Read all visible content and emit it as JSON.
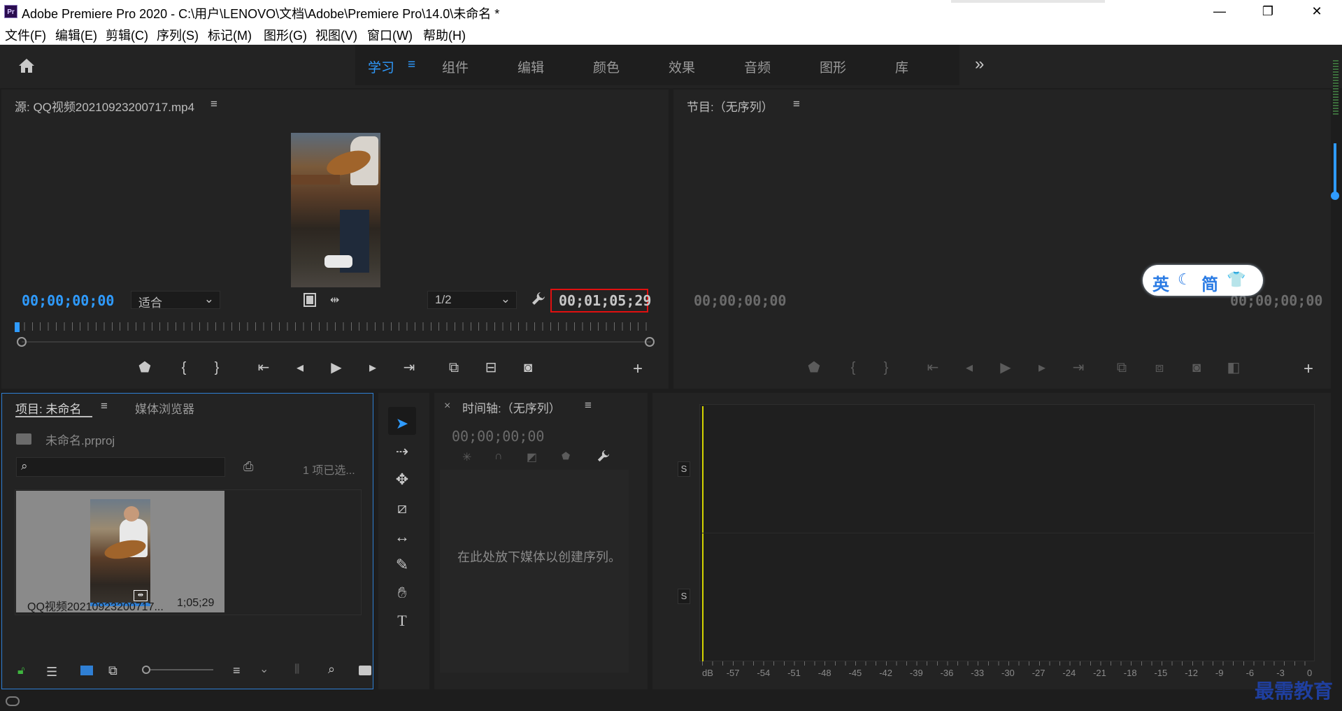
{
  "window": {
    "title": "Adobe Premiere Pro 2020 - C:\\用户\\LENOVO\\文档\\Adobe\\Premiere Pro\\14.0\\未命名 *",
    "logo": "Pr",
    "minimize": "—",
    "restore": "❐",
    "close": "✕"
  },
  "menu": [
    "文件(F)",
    "编辑(E)",
    "剪辑(C)",
    "序列(S)",
    "标记(M)",
    "图形(G)",
    "视图(V)",
    "窗口(W)",
    "帮助(H)"
  ],
  "workspaces": {
    "items": [
      "学习",
      "组件",
      "编辑",
      "颜色",
      "效果",
      "音频",
      "图形",
      "库"
    ],
    "active_menu": "≡",
    "more": "»"
  },
  "source": {
    "title": "源: QQ视频20210923200717.mp4",
    "menu_icon": "≡",
    "timecode_in": "00;00;00;00",
    "fit": "适合",
    "resolution": "1/2",
    "duration": "00;01;05;29"
  },
  "program": {
    "title": "节目:（无序列）",
    "menu_icon": "≡",
    "tc_left": "00;00;00;00",
    "tc_right": "00;00;00;00"
  },
  "project": {
    "tab_project": "项目: 未命名",
    "tab_media": "媒体浏览器",
    "menu_icon": "≡",
    "file": "未命名.prproj",
    "selection": "1 项已选...",
    "clip_name": "QQ视频20210923200717...",
    "clip_duration": "1;05;29"
  },
  "timeline": {
    "close": "×",
    "title": "时间轴:（无序列）",
    "menu_icon": "≡",
    "timecode": "00;00;00;00",
    "empty_text": "在此处放下媒体以创建序列。"
  },
  "audio_meter": {
    "s_label": "S",
    "scale": [
      "dB",
      "-57",
      "-54",
      "-51",
      "-48",
      "-45",
      "-42",
      "-39",
      "-36",
      "-33",
      "-30",
      "-27",
      "-24",
      "-21",
      "-18",
      "-15",
      "-12",
      "-9",
      "-6",
      "-3",
      "0"
    ]
  },
  "ime": {
    "lang": "英",
    "moon": "☾",
    "mode": "简",
    "shirt": "👕"
  },
  "watermark": "最需教育"
}
